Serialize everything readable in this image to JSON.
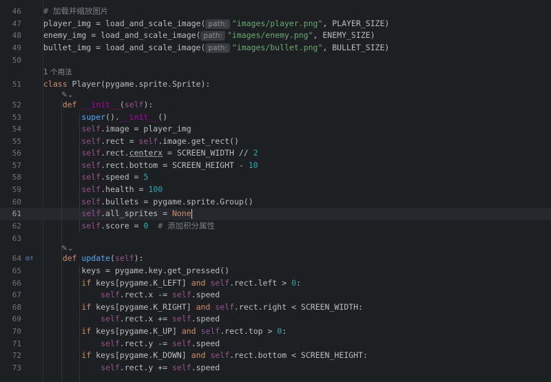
{
  "editor": {
    "active_line": "61",
    "lines": [
      {
        "n": "46",
        "type": "code"
      },
      {
        "n": "47",
        "type": "code"
      },
      {
        "n": "48",
        "type": "code"
      },
      {
        "n": "49",
        "type": "code"
      },
      {
        "n": "50",
        "type": "code"
      },
      {
        "n": "51",
        "type": "code"
      },
      {
        "n": "52",
        "type": "code"
      },
      {
        "n": "53",
        "type": "code"
      },
      {
        "n": "54",
        "type": "code"
      },
      {
        "n": "55",
        "type": "code"
      },
      {
        "n": "56",
        "type": "code"
      },
      {
        "n": "57",
        "type": "code"
      },
      {
        "n": "58",
        "type": "code"
      },
      {
        "n": "59",
        "type": "code"
      },
      {
        "n": "60",
        "type": "code"
      },
      {
        "n": "61",
        "type": "code"
      },
      {
        "n": "62",
        "type": "code"
      },
      {
        "n": "63",
        "type": "code"
      },
      {
        "n": "64",
        "type": "code"
      },
      {
        "n": "65",
        "type": "code"
      },
      {
        "n": "66",
        "type": "code"
      },
      {
        "n": "67",
        "type": "code"
      },
      {
        "n": "68",
        "type": "code"
      },
      {
        "n": "69",
        "type": "code"
      },
      {
        "n": "70",
        "type": "code"
      },
      {
        "n": "71",
        "type": "code"
      },
      {
        "n": "72",
        "type": "code"
      },
      {
        "n": "73",
        "type": "code"
      }
    ],
    "text": {
      "c46": "# 加载并缩放图片",
      "l47a": "player_img = load_and_scale_image(",
      "hint_path": "path:",
      "s47": "\"images/player.png\"",
      "l47b": ", PLAYER_SIZE)",
      "l48a": "enemy_img = load_and_scale_image(",
      "s48": "\"images/enemy.png\"",
      "l48b": ", ENEMY_SIZE)",
      "l49a": "bullet_img = load_and_scale_image(",
      "s49": "\"images/bullet.png\"",
      "l49b": ", BULLET_SIZE)",
      "usage1": "1 个用法",
      "kw_class": "class",
      "l51": " Player(pygame.sprite.Sprite):",
      "kw_def": "def",
      "fn_init": "__init__",
      "self": "self",
      "l52b": "):",
      "fn_super": "super",
      "l53b": "().",
      "l53c": "()",
      "l54": ".image = player_img",
      "l55a": ".rect = ",
      "l55b": ".image.get_rect()",
      "l56a": ".rect.",
      "l56u": "centerx",
      "l56b": " = SCREEN_WIDTH // ",
      "n2": "2",
      "l57": ".rect.bottom = SCREEN_HEIGHT - ",
      "n10": "10",
      "l58": ".speed = ",
      "n5": "5",
      "l59": ".health = ",
      "n100": "100",
      "l60": ".bullets = pygame.sprite.Group()",
      "l61": ".all_sprites = ",
      "kw_none": "None",
      "l62": ".score = ",
      "n0": "0",
      "c62": "  # 添加积分属性",
      "fn_update": "update",
      "l65": "keys = pygame.key.get_pressed()",
      "kw_if": "if",
      "kw_and": "and",
      "l66a": " keys[pygame.K_LEFT] ",
      "l66b": ".rect.left > ",
      "l66c": ":",
      "l67": ".rect.x -= ",
      "speed": ".speed",
      "l68a": " keys[pygame.K_RIGHT] ",
      "l68b": ".rect.right < SCREEN_WIDTH:",
      "l69": ".rect.x += ",
      "l70a": " keys[pygame.K_UP] ",
      "l70b": ".rect.top > ",
      "l71": ".rect.y -= ",
      "l72a": " keys[pygame.K_DOWN] ",
      "l72b": ".rect.bottom < SCREEN_HEIGHT:",
      "l73": ".rect.y += "
    }
  }
}
